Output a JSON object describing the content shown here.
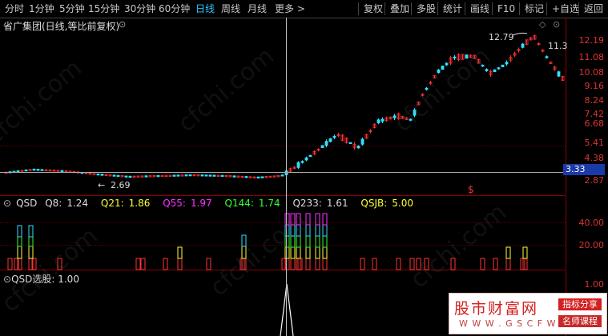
{
  "toolbar": {
    "periods": [
      "分时",
      "1分钟",
      "5分钟",
      "15分钟",
      "30分钟",
      "60分钟",
      "日线",
      "周线",
      "月线",
      "更多 >"
    ],
    "active_period": "日线",
    "actions": [
      "复权",
      "叠加",
      "多股",
      "统计",
      "画线",
      "F10",
      "标记",
      "+自选",
      "返回"
    ]
  },
  "main": {
    "title": "省广集团(日线,等比前复权)",
    "high_label": "12.79",
    "low_label": "2.69",
    "right_price_label": "11.3",
    "price_tag": "3.33",
    "marker": "$",
    "axis_ticks": [
      "12.19",
      "11.08",
      "10.08",
      "9.16",
      "8.24",
      "7.42",
      "6.68",
      "5.41",
      "4.38",
      "2.87"
    ]
  },
  "qsd": {
    "name": "QSD",
    "q8_label": "Q8:",
    "q8_value": "1.24",
    "q21_label": "Q21:",
    "q21_value": "1.86",
    "q55_label": "Q55:",
    "q55_value": "1.97",
    "q144_label": "Q144:",
    "q144_value": "1.74",
    "q233_label": "Q233:",
    "q233_value": "1.61",
    "qsjb_label": "QSJB:",
    "qsjb_value": "5.00",
    "axis_ticks": [
      "40.00",
      "20.00"
    ]
  },
  "select": {
    "title": "QSD选股",
    "value": ": 1.00",
    "axis_ticks": [
      "1.00"
    ]
  },
  "logo": {
    "name": "股市财富网",
    "url": "W W W . G S C F W . C O M",
    "tag1": "指标分享",
    "tag2": "名师课程"
  },
  "watermark_text": "cfchi.com",
  "colors": {
    "up": "#ff3333",
    "down": "#33e0ff",
    "q21": "#ffff33",
    "q55": "#ff33ff",
    "q144": "#33ff33",
    "q233": "#ffffff"
  }
}
